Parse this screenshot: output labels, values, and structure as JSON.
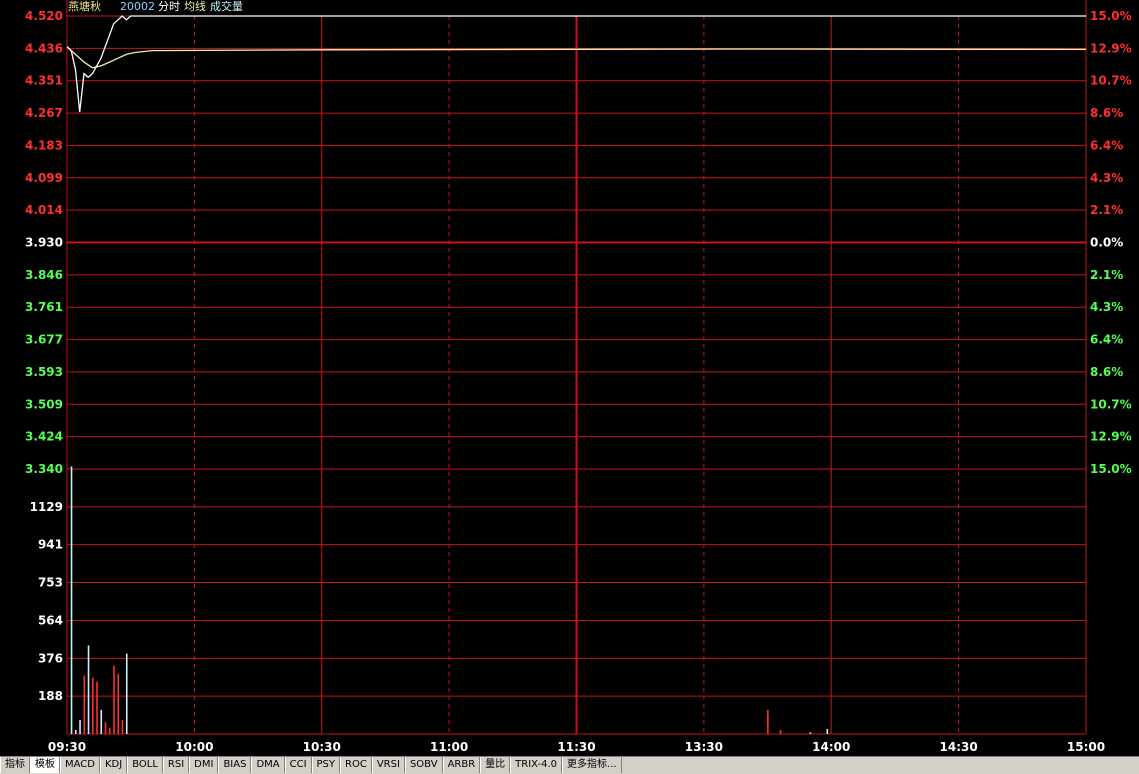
{
  "header": {
    "stock_name": "燕塘秋",
    "volume_value": "20002",
    "indicator_labels": [
      "分时",
      "均线",
      "成交量"
    ]
  },
  "tabs": [
    "指标",
    "模板",
    "MACD",
    "KDJ",
    "BOLL",
    "RSI",
    "DMI",
    "BIAS",
    "DMA",
    "CCI",
    "PSY",
    "ROC",
    "VRSI",
    "SOBV",
    "ARBR",
    "量比",
    "TRIX-4.0",
    "更多指标..."
  ],
  "active_tab": 1,
  "colors": {
    "grid": "#c8141e",
    "up": "#ff3030",
    "down": "#55ff55",
    "flat": "#ffffff",
    "price_line": "#ffffff",
    "avg_line": "#f0f0b4",
    "volume_bar": "#c8f0ff",
    "stock_name": "#f0e68c",
    "volume_value": "#8fd0ff"
  },
  "chart_data": [
    {
      "type": "line",
      "title": "分时",
      "prev_close": 3.93,
      "ylim": [
        3.34,
        4.52
      ],
      "y_ticks": [
        "4.520",
        "4.436",
        "4.351",
        "4.267",
        "4.183",
        "4.099",
        "4.014",
        "3.930",
        "3.846",
        "3.761",
        "3.677",
        "3.593",
        "3.509",
        "3.424",
        "3.340"
      ],
      "right_ticks": [
        "15.0%",
        "12.9%",
        "10.7%",
        "8.6%",
        "6.4%",
        "4.3%",
        "2.1%",
        "0.0%",
        "2.1%",
        "4.3%",
        "6.4%",
        "8.6%",
        "10.7%",
        "12.9%",
        "15.0%"
      ],
      "x_ticks": [
        "09:30",
        "10:00",
        "10:30",
        "11:00",
        "11:30",
        "13:30",
        "14:00",
        "14:30",
        "15:00"
      ],
      "total_minutes": 240,
      "series": [
        {
          "name": "分时",
          "x": [
            0,
            1,
            2,
            3,
            4,
            5,
            6,
            7,
            8,
            9,
            10,
            11,
            12,
            13,
            14,
            15,
            240
          ],
          "values": [
            4.44,
            4.43,
            4.38,
            4.27,
            4.37,
            4.36,
            4.37,
            4.39,
            4.41,
            4.44,
            4.47,
            4.5,
            4.51,
            4.52,
            4.51,
            4.52,
            4.52
          ]
        },
        {
          "name": "均线",
          "x": [
            0,
            2,
            4,
            6,
            8,
            10,
            12,
            14,
            16,
            20,
            60,
            160,
            240
          ],
          "values": [
            4.44,
            4.42,
            4.4,
            4.385,
            4.39,
            4.4,
            4.41,
            4.42,
            4.425,
            4.43,
            4.432,
            4.434,
            4.433
          ]
        }
      ]
    },
    {
      "type": "bar",
      "title": "成交量",
      "ylim": [
        0,
        1317
      ],
      "y_ticks": [
        "1129",
        "941",
        "753",
        "564",
        "376",
        "188"
      ],
      "x": [
        1,
        3,
        4,
        5,
        6,
        7,
        8,
        9,
        10,
        11,
        12,
        13,
        14,
        15,
        16,
        17,
        18,
        19,
        20,
        21,
        22,
        23,
        24,
        25,
        26,
        27,
        28,
        29,
        30,
        31,
        32,
        33,
        34,
        35,
        36,
        37,
        38,
        39,
        40,
        41,
        42,
        43,
        44,
        45,
        46,
        47,
        48,
        49,
        50,
        51,
        52,
        53,
        54,
        55,
        56,
        57,
        58,
        59,
        60,
        61,
        62,
        63,
        64,
        65,
        66,
        67,
        68,
        69,
        70,
        71,
        72,
        73,
        74,
        75,
        76,
        77,
        78,
        79,
        80,
        81,
        82,
        83,
        84,
        85,
        86,
        87,
        88,
        89,
        90,
        91,
        92,
        93,
        94,
        95,
        96,
        97,
        98,
        99,
        100,
        101,
        102,
        103,
        104,
        105,
        106,
        107,
        108,
        109,
        110,
        111,
        112,
        113,
        114,
        115,
        116,
        117,
        118,
        119,
        120,
        121,
        122,
        123,
        124,
        125,
        126,
        127,
        128,
        129,
        130,
        131,
        132,
        133,
        134,
        135,
        136,
        137,
        138,
        139,
        140,
        141,
        142,
        143,
        144,
        145,
        146,
        147,
        148,
        149,
        150,
        151,
        152,
        153,
        154,
        155,
        156,
        157,
        158,
        159,
        160,
        161,
        162,
        163,
        164,
        165,
        166,
        167,
        168,
        169,
        170,
        171,
        172,
        173,
        174,
        175,
        176,
        177,
        178,
        179,
        180,
        181,
        182,
        183,
        184,
        185,
        186,
        187,
        188,
        189,
        190,
        191,
        192,
        193,
        194,
        195,
        196,
        197,
        198,
        199,
        200,
        201,
        202,
        203,
        204,
        205,
        206,
        207,
        208,
        209,
        210,
        211,
        212,
        213,
        214,
        215,
        216,
        217,
        218,
        219,
        220,
        221,
        222,
        223,
        224,
        225,
        226,
        227,
        228,
        229,
        230,
        231,
        232,
        233,
        234,
        235,
        236,
        237,
        238,
        239,
        240
      ],
      "values": [
        1330,
        20,
        0,
        0,
        0,
        0,
        0,
        0,
        0,
        0,
        0,
        0,
        0,
        0,
        0,
        0,
        0,
        0,
        0,
        0,
        0,
        0,
        0,
        0,
        0,
        0,
        0,
        0,
        0,
        0,
        0,
        0,
        0,
        0,
        0,
        0,
        0,
        0,
        0,
        0,
        0,
        0,
        0,
        0,
        0,
        0,
        0,
        0,
        0,
        0,
        0,
        0,
        0,
        0,
        0,
        0,
        0,
        0,
        0,
        0,
        0,
        0,
        0,
        0,
        0,
        0,
        0,
        0,
        0,
        0,
        0,
        0,
        0,
        0,
        0,
        0,
        0,
        0,
        0,
        0,
        0,
        0,
        0,
        0,
        0,
        0,
        0,
        0,
        0,
        0,
        0,
        0,
        0,
        0,
        0,
        0,
        0,
        0,
        0,
        0,
        0,
        0,
        0,
        0,
        0,
        0,
        0,
        0,
        0,
        0,
        0,
        0,
        0,
        0,
        0,
        0,
        0,
        0,
        0,
        0,
        0,
        0,
        0,
        0,
        0,
        0,
        0,
        0,
        0,
        0,
        0,
        0,
        0,
        0,
        0,
        0,
        0,
        0,
        0,
        0,
        0,
        0,
        0,
        0,
        0,
        0,
        0,
        0,
        0,
        0,
        0,
        0,
        0,
        0,
        0,
        0,
        0,
        0,
        0,
        0,
        0,
        0,
        0,
        0,
        0,
        0,
        0,
        0,
        0,
        0,
        0,
        0,
        0,
        0,
        0,
        0,
        0,
        0,
        0,
        0,
        0,
        0,
        0,
        0,
        0,
        0,
        0,
        0,
        0,
        0,
        0,
        0,
        0,
        0,
        0,
        0,
        0,
        0,
        0,
        0,
        0,
        0,
        0,
        0,
        0,
        0,
        0,
        0,
        0,
        0,
        0,
        0,
        0,
        0,
        0,
        0,
        0,
        0,
        0,
        0,
        0,
        0,
        0,
        0,
        0,
        0,
        0,
        0,
        0,
        0,
        0,
        0,
        0,
        0,
        0,
        0,
        0,
        0,
        0,
        0,
        0,
        0,
        0,
        0,
        0,
        0,
        0,
        0,
        0
      ],
      "bars": [
        {
          "x": 1,
          "v": 1330,
          "dir": "flat"
        },
        {
          "x": 2,
          "v": 20,
          "dir": "flat"
        },
        {
          "x": 3,
          "v": 70,
          "dir": "flat"
        },
        {
          "x": 4,
          "v": 290,
          "dir": "up"
        },
        {
          "x": 5,
          "v": 440,
          "dir": "flat"
        },
        {
          "x": 6,
          "v": 280,
          "dir": "up"
        },
        {
          "x": 7,
          "v": 260,
          "dir": "up"
        },
        {
          "x": 8,
          "v": 120,
          "dir": "flat"
        },
        {
          "x": 9,
          "v": 60,
          "dir": "up"
        },
        {
          "x": 10,
          "v": 30,
          "dir": "up"
        },
        {
          "x": 11,
          "v": 340,
          "dir": "up"
        },
        {
          "x": 12,
          "v": 300,
          "dir": "up"
        },
        {
          "x": 13,
          "v": 70,
          "dir": "up"
        },
        {
          "x": 14,
          "v": 400,
          "dir": "flat"
        },
        {
          "x": 165,
          "v": 120,
          "dir": "up"
        },
        {
          "x": 168,
          "v": 20,
          "dir": "up"
        },
        {
          "x": 175,
          "v": 8,
          "dir": "flat"
        },
        {
          "x": 179,
          "v": 25,
          "dir": "flat"
        }
      ]
    }
  ]
}
